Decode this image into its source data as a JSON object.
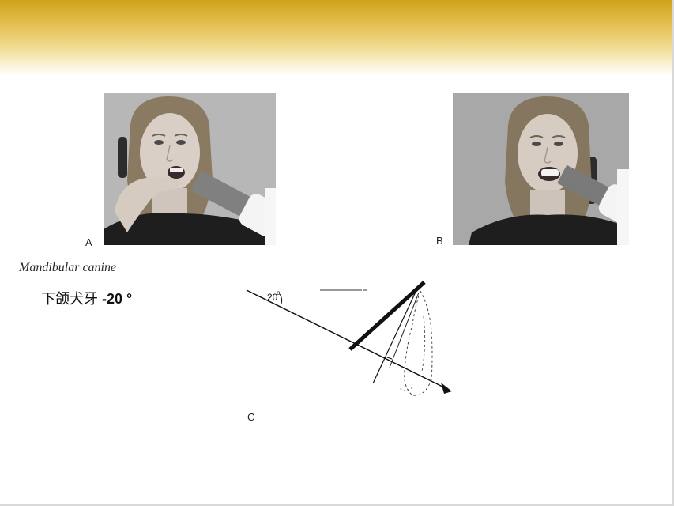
{
  "figure_labels": {
    "a": "A",
    "b": "B",
    "c": "C"
  },
  "heading": {
    "tooth_name": "Mandibular canine"
  },
  "angle_note": {
    "chinese": "下颌犬牙",
    "value": "-20 °"
  },
  "diagram": {
    "angle_label": "20"
  },
  "photos": {
    "a": {
      "subject": "patient holding film with finger, x-ray tube at lower jaw"
    },
    "b": {
      "subject": "patient biting film holder, x-ray tube at lower jaw"
    }
  },
  "colors": {
    "band_top": "#d0a21c",
    "band_bottom": "#fffdf6",
    "text": "#111111"
  }
}
